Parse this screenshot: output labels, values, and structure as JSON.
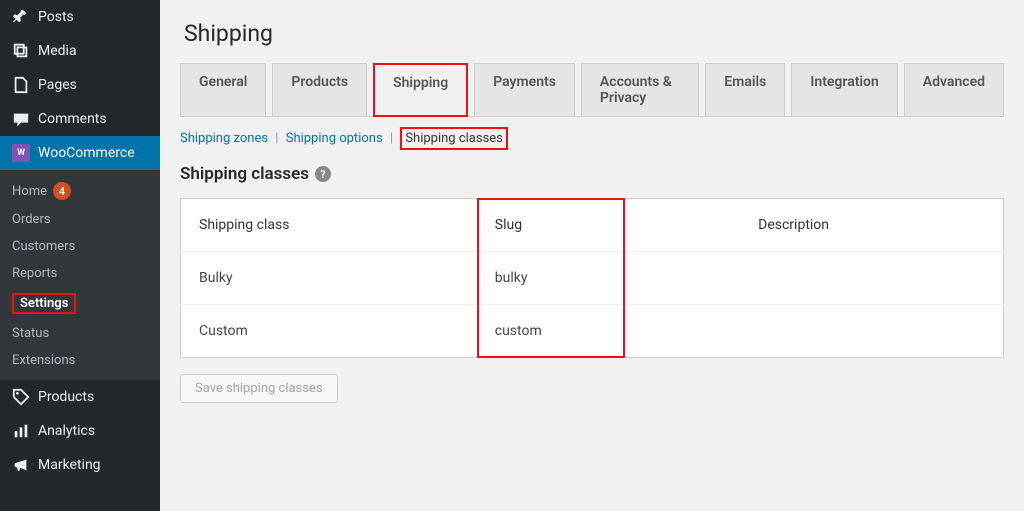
{
  "sidebar": {
    "posts": "Posts",
    "media": "Media",
    "pages": "Pages",
    "comments": "Comments",
    "woocommerce": "WooCommerce",
    "wc_sub": {
      "home": "Home",
      "home_badge": "4",
      "orders": "Orders",
      "customers": "Customers",
      "reports": "Reports",
      "settings": "Settings",
      "status": "Status",
      "extensions": "Extensions"
    },
    "products": "Products",
    "analytics": "Analytics",
    "marketing": "Marketing"
  },
  "page": {
    "title": "Shipping",
    "section_title": "Shipping classes"
  },
  "tabs": {
    "general": "General",
    "products": "Products",
    "shipping": "Shipping",
    "payments": "Payments",
    "accounts": "Accounts & Privacy",
    "emails": "Emails",
    "integration": "Integration",
    "advanced": "Advanced"
  },
  "subtabs": {
    "zones": "Shipping zones",
    "options": "Shipping options",
    "classes": "Shipping classes"
  },
  "table": {
    "headers": {
      "class": "Shipping class",
      "slug": "Slug",
      "description": "Description"
    },
    "rows": [
      {
        "class": "Bulky",
        "slug": "bulky",
        "description": ""
      },
      {
        "class": "Custom",
        "slug": "custom",
        "description": ""
      }
    ]
  },
  "buttons": {
    "save": "Save shipping classes"
  }
}
